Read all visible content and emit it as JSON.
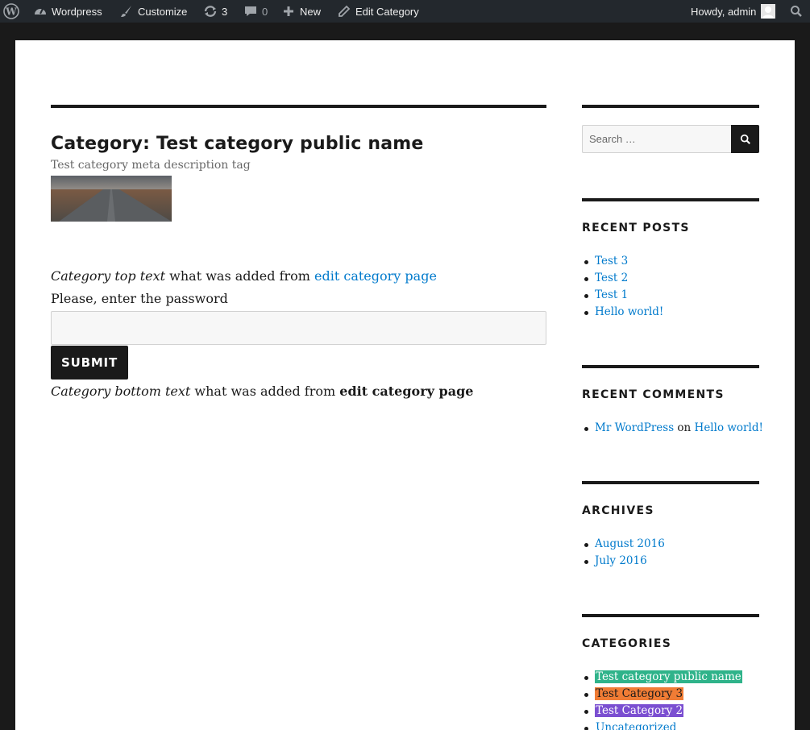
{
  "admin_bar": {
    "site_name": "Wordpress",
    "customize": "Customize",
    "updates_count": "3",
    "comments_count": "0",
    "new_label": "New",
    "edit_category": "Edit Category",
    "howdy": "Howdy, admin"
  },
  "main": {
    "title": "Category: Test category public name",
    "meta_description": "Test category meta description tag",
    "top_text_em": "Category top text",
    "top_text_mid": " what was added from ",
    "top_text_link": "edit category page",
    "password_prompt": "Please, enter the password",
    "password_value": "",
    "submit_label": "SUBMIT",
    "bottom_text_em": "Category bottom text",
    "bottom_text_mid": " what was added from ",
    "bottom_text_bold": "edit category page"
  },
  "sidebar": {
    "search_placeholder": "Search …",
    "recent_posts": {
      "title": "RECENT POSTS",
      "items": [
        "Test 3",
        "Test 2",
        "Test 1",
        "Hello world!"
      ]
    },
    "recent_comments": {
      "title": "RECENT COMMENTS",
      "author": "Mr WordPress",
      "on": " on ",
      "post": "Hello world!"
    },
    "archives": {
      "title": "ARCHIVES",
      "items": [
        "August 2016",
        "July 2016"
      ]
    },
    "categories": {
      "title": "CATEGORIES",
      "items": [
        {
          "label": "Test category public name",
          "bg": "#2fb38a",
          "color": "#ffffff"
        },
        {
          "label": "Test Category 3",
          "bg": "#f07c35",
          "color": "#1a1a1a"
        },
        {
          "label": "Test Category 2",
          "bg": "#7b4fd1",
          "color": "#ffffff"
        },
        {
          "label": "Uncategorized",
          "bg": "",
          "color": "#007acc"
        }
      ]
    }
  }
}
